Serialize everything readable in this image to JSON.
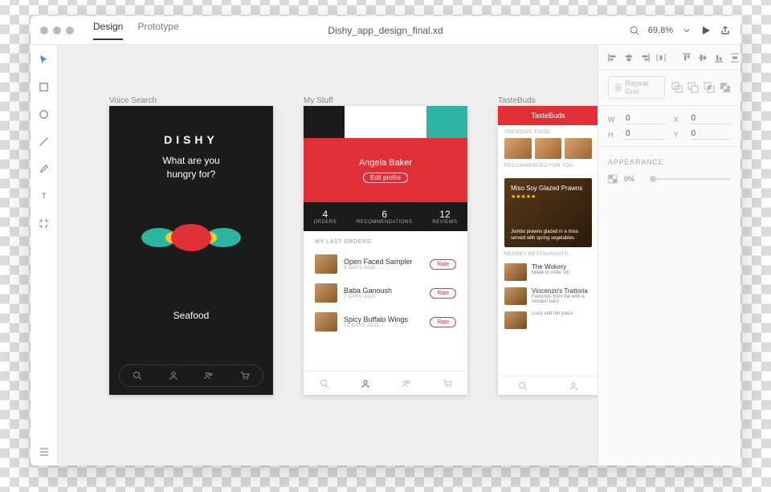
{
  "titlebar": {
    "mode_design": "Design",
    "mode_prototype": "Prototype",
    "filename": "Dishy_app_design_final.xd",
    "zoom": "69.8%"
  },
  "artboards": {
    "voice": {
      "label": "Voice Search",
      "brand": "DISHY",
      "prompt_l1": "What are you",
      "prompt_l2": "hungry for?",
      "listening": "Seafood"
    },
    "mystuff": {
      "label": "My Stuff",
      "profile_name": "Angela Baker",
      "edit": "Edit profile",
      "stats": [
        {
          "num": "4",
          "lbl": "ORDERS"
        },
        {
          "num": "6",
          "lbl": "RECOMMENDATIONS"
        },
        {
          "num": "12",
          "lbl": "REVIEWS"
        }
      ],
      "section": "MY LAST ORDERS",
      "orders": [
        {
          "name": "Open Faced Sampler",
          "age": "3 DAYS AGO"
        },
        {
          "name": "Baba Ganoush",
          "age": "7 DAYS AGO"
        },
        {
          "name": "Spicy Buffalo Wings",
          "age": "12 DAYS AGO"
        }
      ],
      "rate": "Rate"
    },
    "taste": {
      "label": "TasteBuds",
      "header": "TasteBuds",
      "trending": "TRENDING FOOD",
      "recommended": "RECOMMENDED FOR YOU",
      "feature_title": "Miso Soy Glazed Prawns",
      "feature_stars": "★★★★★",
      "feature_desc": "Jumbo prawns glazed in a miso served with spring vegetables",
      "nearby": "NEARBY RESTAURANTS",
      "restaurants": [
        {
          "name": "The Wokery",
          "desc": "Made to order stir"
        },
        {
          "name": "Vincenzo's Trattoria",
          "desc": "Favorites from the with a modern twist"
        },
        {
          "name": "",
          "desc": "Cozy and fun place"
        }
      ]
    }
  },
  "rpanel": {
    "repeat": "Repeat Grid",
    "w": "W",
    "wv": "0",
    "h": "H",
    "hv": "0",
    "x": "X",
    "xv": "0",
    "y": "Y",
    "yv": "0",
    "appearance": "APPEARANCE",
    "opacity": "0%"
  }
}
